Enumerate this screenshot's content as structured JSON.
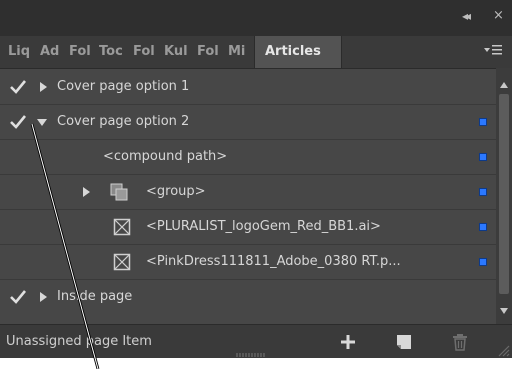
{
  "panel": {
    "title_buttons": {
      "collapse": "◂◂",
      "close": "×"
    },
    "tabs": [
      "Liq",
      "Ad",
      "Fol",
      "Toc",
      "Fol",
      "Kul",
      "Fol",
      "Mi",
      "Articles"
    ],
    "active_tab": "Articles",
    "panel_menu_icon": "panel-menu-icon"
  },
  "rows": [
    {
      "label": "Cover page option 1",
      "checked": true,
      "expanded": false
    },
    {
      "label": "Cover page option 2",
      "checked": true,
      "expanded": true
    },
    {
      "label": "<compound path>"
    },
    {
      "label": "<group>",
      "icon": "group-icon"
    },
    {
      "label": "<PLURALIST_logoGem_Red_BB1.ai>",
      "icon": "placed-graphic-icon"
    },
    {
      "label": "<PinkDress111811_Adobe_0380 RT.p...",
      "icon": "placed-graphic-icon"
    },
    {
      "label": "Inside page",
      "checked": true,
      "expanded": false
    }
  ],
  "status": {
    "label": "Unassigned page Item",
    "icons": [
      "add-icon",
      "new-article-icon",
      "trash-icon"
    ]
  },
  "colors": {
    "panel_bg": "#474747",
    "selection_indicator": "#2b78ff"
  }
}
